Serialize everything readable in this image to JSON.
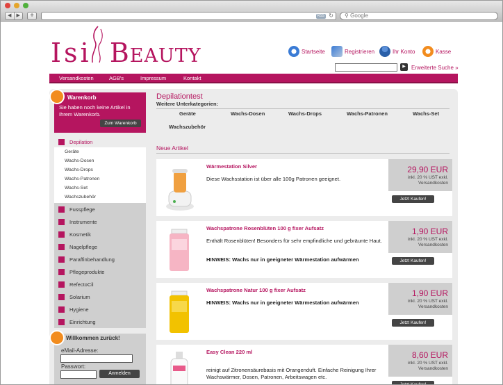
{
  "browser": {
    "back_icon": "◀",
    "forward_icon": "▶",
    "new_tab": "+",
    "rss": "RSS",
    "reload_icon": "↻",
    "search_placeholder": "Google"
  },
  "site": {
    "logo_left": "Isi",
    "logo_right": "Beauty",
    "brand_color": "#b5155f",
    "top_links": [
      "Startseite",
      "Registrieren",
      "Ihr Konto",
      "Kasse"
    ],
    "advanced_search": "Erweiterte Suche »",
    "menu": [
      "Versandkosten",
      "AGB's",
      "Impressum",
      "Kontakt"
    ]
  },
  "cart": {
    "title": "Warenkorb",
    "text": "Sie haben noch keine Artikel in Ihrem Warenkorb.",
    "button": "Zum Warenkorb"
  },
  "categories": {
    "active": "Depilation",
    "subcategories": [
      "Geräte",
      "Wachs-Dosen",
      "Wachs-Drops",
      "Wachs-Patronen",
      "Wachs-Set",
      "Wachszubehör"
    ],
    "others": [
      "Fusspflege",
      "Instrumente",
      "Kosmetik",
      "Nagelpflege",
      "Paraffinbehandlung",
      "Pflegeprodukte",
      "RefectoCil",
      "Solarium",
      "Hygiene",
      "Einrichtung"
    ]
  },
  "login": {
    "title": "Willkommen zurück!",
    "email_label": "eMail-Adresse:",
    "password_label": "Passwort:",
    "button": "Anmelden"
  },
  "main": {
    "title": "Depilationtest",
    "subhead": "Weitere Unterkategorien:",
    "subcat_links": [
      "Geräte",
      "Wachs-Dosen",
      "Wachs-Drops",
      "Wachs-Patronen",
      "Wachs-Set",
      "Wachszubehör"
    ],
    "new_articles": "Neue Artikel",
    "buy_label": "Jetzt Kaufen!",
    "tax_label": "inkl. 20 % UST exkl. Versandkosten",
    "products": [
      {
        "name": "Wärmestation Silver",
        "desc": "Diese Wachsstation ist über alle 100g Patronen geeignet.",
        "note": "",
        "price": "29,90 EUR"
      },
      {
        "name": "Wachspatrone Rosenblüten 100 g fixer Aufsatz",
        "desc": "Enthält Rosenblüten! Besonders für sehr empfindliche und gebräunte Haut.",
        "note": "HINWEIS: Wachs nur in geeigneter Wärmestation aufwärmen",
        "price": "1,90 EUR"
      },
      {
        "name": "Wachspatrone Natur 100 g fixer Aufsatz",
        "desc": "",
        "note": "HINWEIS: Wachs nur in geeigneter Wärmestation aufwärmen",
        "price": "1,90 EUR"
      },
      {
        "name": "Easy Clean 220 ml",
        "desc": "reinigt auf Zitronensäurebasis mit Orangenduft. Einfache Reinigung Ihrer Wachswärmer, Dosen, Patronen, Arbeitswagen etc.",
        "note": "",
        "price": "8,60 EUR"
      }
    ]
  }
}
